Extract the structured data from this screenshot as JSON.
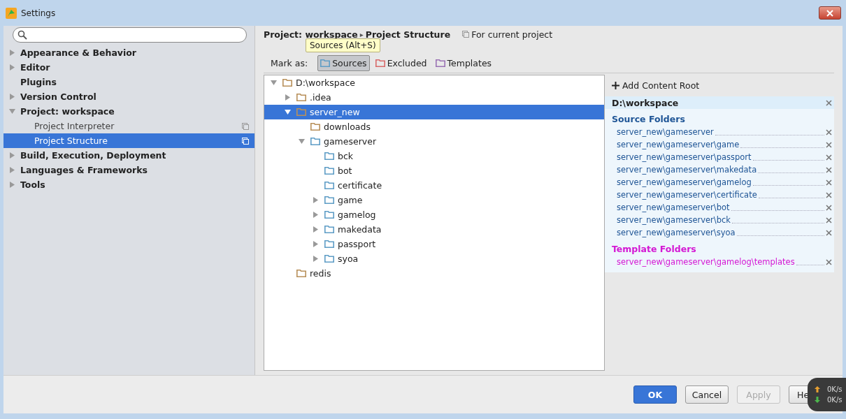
{
  "window": {
    "title": "Settings"
  },
  "sidebar": {
    "items": [
      {
        "label": "Appearance & Behavior",
        "kind": "group",
        "expanded": false,
        "selected": false
      },
      {
        "label": "Editor",
        "kind": "group",
        "expanded": false,
        "selected": false
      },
      {
        "label": "Plugins",
        "kind": "page",
        "selected": false
      },
      {
        "label": "Version Control",
        "kind": "group",
        "expanded": false,
        "selected": false
      },
      {
        "label": "Project: workspace",
        "kind": "group",
        "expanded": true,
        "selected": false,
        "children": [
          {
            "label": "Project Interpreter",
            "kind": "project_page",
            "selected": false
          },
          {
            "label": "Project Structure",
            "kind": "project_page",
            "selected": true
          }
        ]
      },
      {
        "label": "Build, Execution, Deployment",
        "kind": "group",
        "expanded": false,
        "selected": false
      },
      {
        "label": "Languages & Frameworks",
        "kind": "group",
        "expanded": false,
        "selected": false
      },
      {
        "label": "Tools",
        "kind": "group",
        "expanded": false,
        "selected": false
      }
    ]
  },
  "breadcrumb": {
    "parent": "Project: workspace",
    "separator": "▸",
    "current": "Project Structure",
    "scope": "For current project"
  },
  "tooltip": "Sources (Alt+S)",
  "mark_as": {
    "label": "Mark as:",
    "buttons": [
      {
        "label": "Sources",
        "color": "#5f9dc6",
        "selected": true
      },
      {
        "label": "Excluded",
        "color": "#d86a6a",
        "selected": false
      },
      {
        "label": "Templates",
        "color": "#9a72b4",
        "selected": false
      }
    ]
  },
  "tree": [
    {
      "name": "D:\\workspace",
      "color": "#b8905a",
      "kind": "branch",
      "expanded": true,
      "selected": false,
      "children": [
        {
          "name": ".idea",
          "color": "#b8905a",
          "kind": "branch",
          "expanded": false,
          "selected": false
        },
        {
          "name": "server_new",
          "color": "#b8905a",
          "kind": "branch",
          "expanded": true,
          "selected": true,
          "children": [
            {
              "name": "downloads",
              "color": "#b8905a",
              "kind": "leaf",
              "selected": false
            },
            {
              "name": "gameserver",
              "color": "#5f9dc6",
              "kind": "branch",
              "expanded": true,
              "selected": false,
              "children": [
                {
                  "name": "bck",
                  "color": "#5f9dc6",
                  "kind": "leaf",
                  "selected": false
                },
                {
                  "name": "bot",
                  "color": "#5f9dc6",
                  "kind": "leaf",
                  "selected": false
                },
                {
                  "name": "certificate",
                  "color": "#5f9dc6",
                  "kind": "leaf",
                  "selected": false
                },
                {
                  "name": "game",
                  "color": "#5f9dc6",
                  "kind": "branch",
                  "expanded": false,
                  "selected": false
                },
                {
                  "name": "gamelog",
                  "color": "#5f9dc6",
                  "kind": "branch",
                  "expanded": false,
                  "selected": false
                },
                {
                  "name": "makedata",
                  "color": "#5f9dc6",
                  "kind": "branch",
                  "expanded": false,
                  "selected": false
                },
                {
                  "name": "passport",
                  "color": "#5f9dc6",
                  "kind": "branch",
                  "expanded": false,
                  "selected": false
                },
                {
                  "name": "syoa",
                  "color": "#5f9dc6",
                  "kind": "branch",
                  "expanded": false,
                  "selected": false
                }
              ]
            }
          ]
        },
        {
          "name": "redis",
          "color": "#b8905a",
          "kind": "leaf",
          "selected": false
        }
      ]
    }
  ],
  "content_roots": {
    "add_label": "Add Content Root",
    "root": "D:\\workspace",
    "groups": [
      {
        "title": "Source Folders",
        "color": "#1f5596",
        "folders": [
          "server_new\\gameserver",
          "server_new\\gameserver\\game",
          "server_new\\gameserver\\passport",
          "server_new\\gameserver\\makedata",
          "server_new\\gameserver\\gamelog",
          "server_new\\gameserver\\certificate",
          "server_new\\gameserver\\bot",
          "server_new\\gameserver\\bck",
          "server_new\\gameserver\\syoa"
        ]
      },
      {
        "title": "Template Folders",
        "color": "#d417d4",
        "folders": [
          "server_new\\gameserver\\gamelog\\templates"
        ]
      }
    ]
  },
  "buttons": [
    {
      "label": "OK",
      "kind": "primary",
      "disabled": false
    },
    {
      "label": "Cancel",
      "kind": "normal",
      "disabled": false
    },
    {
      "label": "Apply",
      "kind": "normal",
      "disabled": true
    },
    {
      "label": "He",
      "kind": "normal",
      "disabled": false
    }
  ],
  "net_monitor": {
    "upload": "0K/s",
    "download": "0K/s"
  }
}
